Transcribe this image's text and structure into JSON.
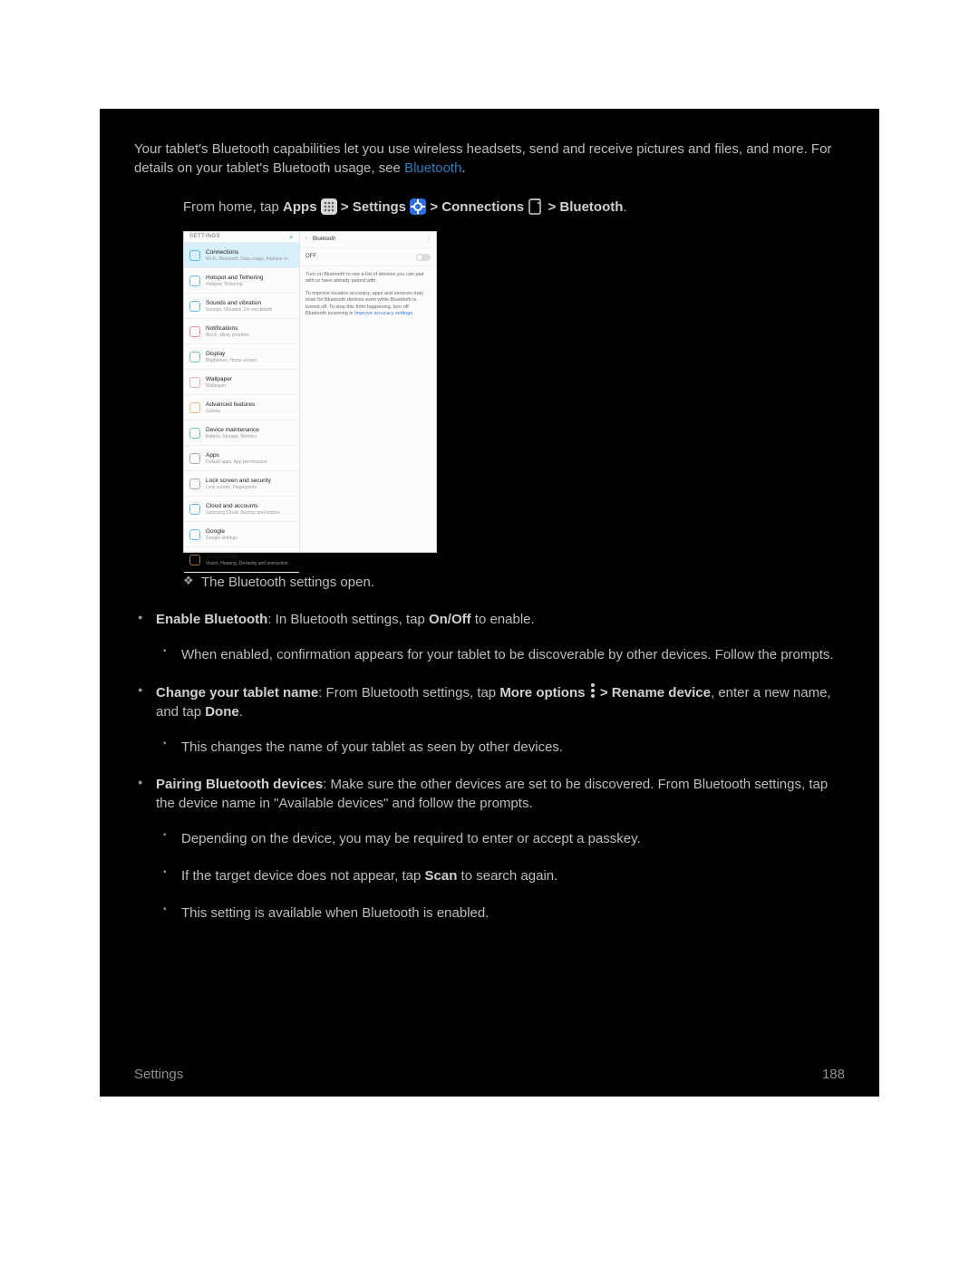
{
  "intro": {
    "text_prefix": "Your tablet's Bluetooth capabilities let you use wireless headsets, send and receive pictures and files, and more. For details on your tablet's Bluetooth usage, see ",
    "link": "Bluetooth",
    "text_suffix": "."
  },
  "nav": {
    "text": "From home, tap ",
    "apps": "Apps",
    "settings": "Settings",
    "connections": "Connections",
    "bluetooth": "Bluetooth",
    "sep": " > "
  },
  "screenshot": {
    "left": {
      "header": "SETTINGS",
      "items": [
        {
          "title": "Connections",
          "sub": "Wi-Fi, Bluetooth, Data usage, Airplane m…",
          "color": "#2aa3d8",
          "selected": true
        },
        {
          "title": "Hotspot and Tethering",
          "sub": "Hotspot, Tethering",
          "color": "#2aa3d8"
        },
        {
          "title": "Sounds and vibration",
          "sub": "Sounds, Vibration, Do not disturb",
          "color": "#2aa3d8"
        },
        {
          "title": "Notifications",
          "sub": "Block, allow, prioritize",
          "color": "#d66"
        },
        {
          "title": "Display",
          "sub": "Brightness, Home screen",
          "color": "#3cb371"
        },
        {
          "title": "Wallpaper",
          "sub": "Wallpaper",
          "color": "#d48fb1"
        },
        {
          "title": "Advanced features",
          "sub": "Games",
          "color": "#e0a040"
        },
        {
          "title": "Device maintenance",
          "sub": "Battery, Storage, Memory",
          "color": "#3cb371"
        },
        {
          "title": "Apps",
          "sub": "Default apps, App permissions",
          "color": "#888"
        },
        {
          "title": "Lock screen and security",
          "sub": "Lock screen, Fingerprints",
          "color": "#888"
        },
        {
          "title": "Cloud and accounts",
          "sub": "Samsung Cloud, Backup and restore",
          "color": "#2aa3d8"
        },
        {
          "title": "Google",
          "sub": "Google settings",
          "color": "#2aa3d8"
        },
        {
          "title": "Accessibility",
          "sub": "Vision, Hearing, Dexterity and interaction",
          "color": "#e0a040"
        }
      ]
    },
    "right": {
      "back": "‹",
      "title": "Bluetooth",
      "dots": "⋮",
      "off": "OFF",
      "info1": "Turn on Bluetooth to see a list of devices you can pair with or have already paired with.",
      "info2_pre": "To improve location accuracy, apps and services may scan for Bluetooth devices even while Bluetooth is turned off. To stop this from happening, turn off Bluetooth scanning in ",
      "info2_link": "Improve accuracy settings",
      "info2_post": "."
    }
  },
  "result": "The Bluetooth settings open.",
  "enable": {
    "label": "Enable Bluetooth",
    "text_mid": ": In Bluetooth settings, tap ",
    "toggle": "On/Off",
    "text_end": " to enable.",
    "sub": "When enabled, confirmation appears for your tablet to be discoverable by other devices. Follow the prompts."
  },
  "rename": {
    "label": "Change your tablet name",
    "t1": ": From Bluetooth settings, tap ",
    "more": "More options",
    "sep": " > ",
    "rename": "Rename device",
    "t2": ", enter a new name, and tap ",
    "done": "Done",
    "t3": ".",
    "sub": "This changes the name of your tablet as seen by other devices."
  },
  "pairing": {
    "label": "Pairing Bluetooth devices",
    "text": ": Make sure the other devices are set to be discovered. From Bluetooth settings, tap the device name in \"Available devices\" and follow the prompts.",
    "subs": {
      "a": "Depending on the device, you may be required to enter or accept a passkey.",
      "b_pre": "If the target device does not appear, tap ",
      "b_scan": "Scan",
      "b_post": " to search again.",
      "c": "This setting is available when Bluetooth is enabled."
    }
  },
  "footer": {
    "left": "Settings",
    "right": "188"
  }
}
